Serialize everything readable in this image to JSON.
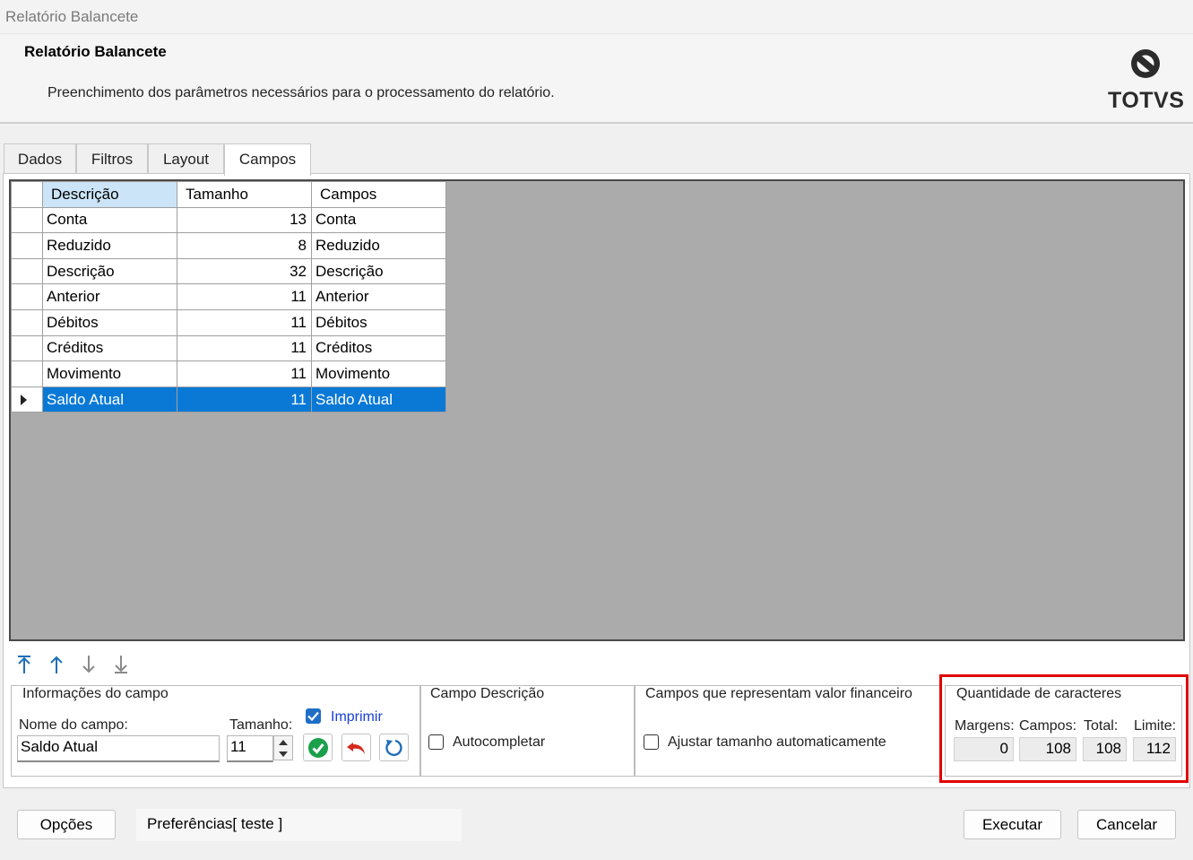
{
  "window": {
    "title": "Relatório Balancete"
  },
  "header": {
    "title": "Relatório Balancete",
    "subtitle": "Preenchimento dos parâmetros necessários para o processamento do relatório.",
    "logo_text": "TOTVS"
  },
  "tabs": [
    {
      "label": "Dados"
    },
    {
      "label": "Filtros"
    },
    {
      "label": "Layout"
    },
    {
      "label": "Campos",
      "active": true
    }
  ],
  "grid": {
    "columns": [
      "Descrição",
      "Tamanho",
      "Campos"
    ],
    "rows": [
      {
        "descricao": "Conta",
        "tamanho": "13",
        "campos": "Conta"
      },
      {
        "descricao": "Reduzido",
        "tamanho": "8",
        "campos": "Reduzido"
      },
      {
        "descricao": "Descrição",
        "tamanho": "32",
        "campos": "Descrição"
      },
      {
        "descricao": "Anterior",
        "tamanho": "11",
        "campos": "Anterior"
      },
      {
        "descricao": "Débitos",
        "tamanho": "11",
        "campos": "Débitos"
      },
      {
        "descricao": "Créditos",
        "tamanho": "11",
        "campos": "Créditos"
      },
      {
        "descricao": "Movimento",
        "tamanho": "11",
        "campos": "Movimento"
      },
      {
        "descricao": "Saldo Atual",
        "tamanho": "11",
        "campos": "Saldo Atual",
        "selected": true
      }
    ]
  },
  "move_buttons": [
    "move-top-icon",
    "move-up-icon",
    "move-down-icon",
    "move-bottom-icon"
  ],
  "info_campo": {
    "caption": "Informações do campo",
    "nome_label": "Nome do campo:",
    "nome_value": "Saldo Atual",
    "tamanho_label": "Tamanho:",
    "tamanho_value": "11",
    "imprimir_label": "Imprimir",
    "imprimir_checked": true
  },
  "campo_descricao": {
    "caption": "Campo Descrição",
    "autocompletar_label": "Autocompletar",
    "checked": false
  },
  "valor_financeiro": {
    "caption": "Campos que representam valor financeiro",
    "ajustar_label": "Ajustar tamanho automaticamente",
    "checked": false
  },
  "quantidade": {
    "caption": "Quantidade de caracteres",
    "margens_label": "Margens:",
    "margens_value": "0",
    "campos_label": "Campos:",
    "campos_value": "108",
    "total_label": "Total:",
    "total_value": "108",
    "limite_label": "Limite:",
    "limite_value": "112"
  },
  "footer": {
    "opcoes_label": "Opções",
    "preferencias_text": "Preferências[ teste ]",
    "executar_label": "Executar",
    "cancelar_label": "Cancelar"
  },
  "colors": {
    "selection": "#0a79d6",
    "header_selected": "#cce4f7",
    "grid_background": "#ababab",
    "highlight": "#e00000",
    "accent": "#1f6fc6"
  }
}
